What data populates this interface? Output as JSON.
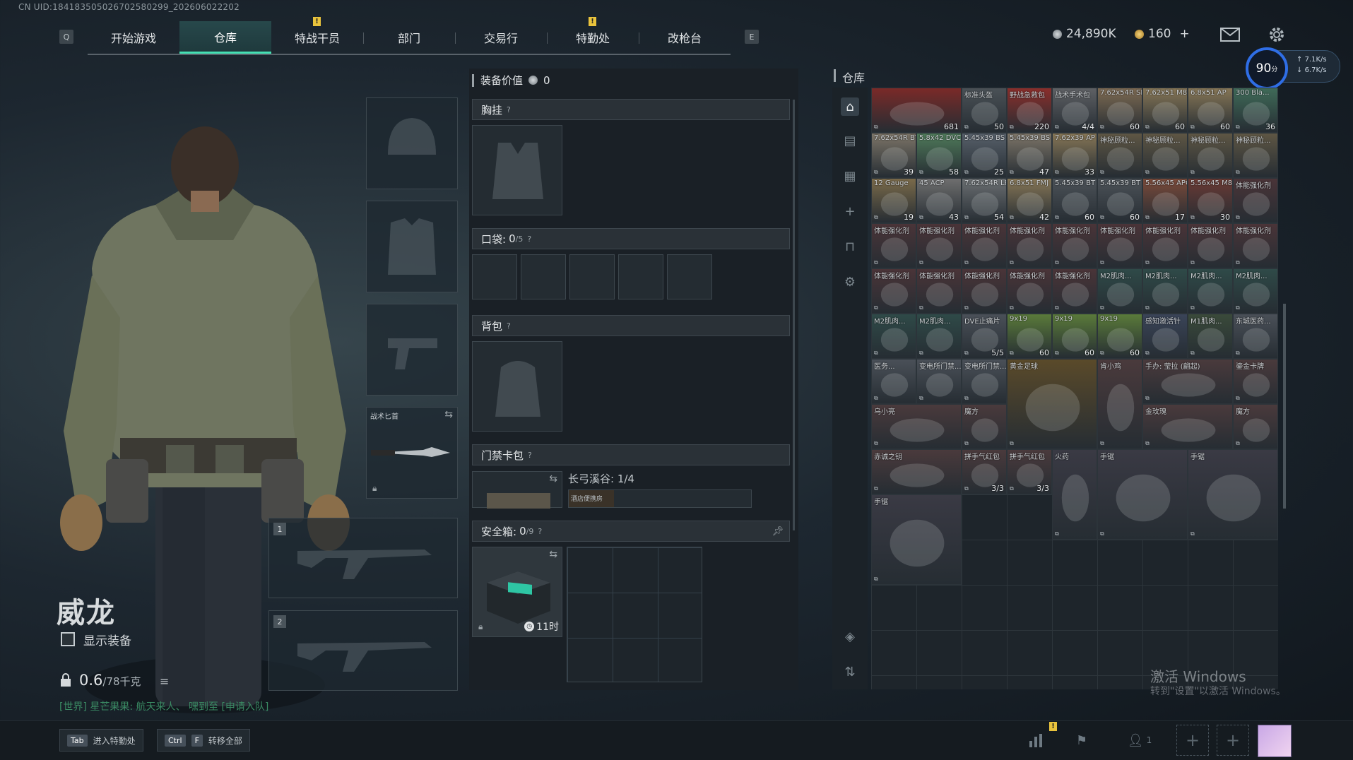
{
  "uid": "CN UID:18418350502670258029‍9_20260602220‍2",
  "nav": {
    "key_left": "Q",
    "key_right": "E",
    "tabs": [
      {
        "label": "开始游戏",
        "active": false,
        "alert": false
      },
      {
        "label": "仓库",
        "active": true,
        "alert": false
      },
      {
        "label": "特战干员",
        "active": false,
        "alert": true
      },
      {
        "label": "部门",
        "active": false,
        "alert": false
      },
      {
        "label": "交易行",
        "active": false,
        "alert": false
      },
      {
        "label": "特勤处",
        "active": false,
        "alert": true
      },
      {
        "label": "改枪台",
        "active": false,
        "alert": false
      }
    ],
    "alert_mark": "!"
  },
  "currency": {
    "silver": "24,890K",
    "gold": "160",
    "gold_add": "+"
  },
  "network": {
    "ping": "90",
    "ping_unit": "分",
    "up": "7.1K/s",
    "down": "6.7K/s"
  },
  "character": {
    "name": "威龙",
    "show_gear_label": "显示装备",
    "weight": "0.6",
    "weight_max": "/78千克",
    "chat_text": "[世界] 星芒果果: 航天来人、 嘿到至 [申请入队]"
  },
  "equipment": {
    "melee_label": "战术匕首",
    "slot1": "1",
    "slot2": "2"
  },
  "loadout": {
    "value_label": "装备价值",
    "value": "0",
    "chest_label": "胸挂",
    "pocket_label": "口袋:",
    "pocket_count": "0",
    "pocket_max": "/5",
    "backpack_label": "背包",
    "keycard_label": "门禁卡包",
    "keycard_map": "长弓溪谷: 1/4",
    "keycard_item": "酒店便携房",
    "safe_label": "安全箱:",
    "safe_count": "0",
    "safe_max": "/9",
    "safe_timer": "11时",
    "help": "?"
  },
  "warehouse": {
    "title": "仓库",
    "items": [
      {
        "name": "",
        "count": "681",
        "color": "#7a2a28",
        "w": 2,
        "h": 1
      },
      {
        "name": "标准头盔",
        "count": "50",
        "color": "#4a5156",
        "w": 1,
        "h": 1
      },
      {
        "name": "野战急救包",
        "count": "220",
        "color": "#8a2e2b",
        "w": 1,
        "h": 1
      },
      {
        "name": "战术手术包",
        "count": "4/4",
        "color": "#5e6064",
        "w": 1,
        "h": 1
      },
      {
        "name": "7.62x54R SNB",
        "count": "60",
        "color": "#7d6a52",
        "w": 1,
        "h": 1
      },
      {
        "name": "7.62x51 M80",
        "count": "60",
        "color": "#867656",
        "w": 1,
        "h": 1
      },
      {
        "name": "6.8x51 AP",
        "count": "60",
        "color": "#867656",
        "w": 1,
        "h": 1
      },
      {
        "name": "300 Bla...",
        "count": "36",
        "color": "#3f6a58",
        "w": 1,
        "h": 1
      },
      {
        "name": "7.62x54R BT",
        "count": "39",
        "color": "#7d7568",
        "w": 1,
        "h": 1
      },
      {
        "name": "5.8x42 DVC12",
        "count": "58",
        "color": "#4f7a5a",
        "w": 1,
        "h": 1
      },
      {
        "name": "5.45x39 BS",
        "count": "25",
        "color": "#57606a",
        "w": 1,
        "h": 1
      },
      {
        "name": "5.45x39 BS",
        "count": "47",
        "color": "#7d7568",
        "w": 1,
        "h": 1
      },
      {
        "name": "7.62x39 AP",
        "count": "33",
        "color": "#867656",
        "w": 1,
        "h": 1
      },
      {
        "name": "神秘顾粒...",
        "count": "",
        "color": "#5e5644",
        "w": 1,
        "h": 1
      },
      {
        "name": "神秘顾粒...",
        "count": "",
        "color": "#5e5644",
        "w": 1,
        "h": 1
      },
      {
        "name": "神秘顾粒...",
        "count": "",
        "color": "#5e5644",
        "w": 1,
        "h": 1
      },
      {
        "name": "神秘顾粒...",
        "count": "",
        "color": "#5e5644",
        "w": 1,
        "h": 1
      },
      {
        "name": "12 Gauge",
        "count": "19",
        "color": "#7a6a4a",
        "w": 1,
        "h": 1
      },
      {
        "name": "45 ACP",
        "count": "43",
        "color": "#6e6e6e",
        "w": 1,
        "h": 1
      },
      {
        "name": "7.62x54R LPS",
        "count": "54",
        "color": "#6b6f72",
        "w": 1,
        "h": 1
      },
      {
        "name": "6.8x51 FMJ",
        "count": "42",
        "color": "#867656",
        "w": 1,
        "h": 1
      },
      {
        "name": "5.45x39 BT",
        "count": "60",
        "color": "#4c5258",
        "w": 1,
        "h": 1
      },
      {
        "name": "5.45x39 BT",
        "count": "60",
        "color": "#4c5258",
        "w": 1,
        "h": 1
      },
      {
        "name": "5.56x45 APC",
        "count": "17",
        "color": "#7a4a3a",
        "w": 1,
        "h": 1
      },
      {
        "name": "5.56x45 M855A1",
        "count": "30",
        "color": "#6a3a34",
        "w": 1,
        "h": 1
      },
      {
        "name": "体能强化剂",
        "count": "",
        "color": "#4a3438",
        "w": 1,
        "h": 1
      },
      {
        "name": "体能强化剂",
        "count": "",
        "color": "#4a3438",
        "w": 1,
        "h": 1
      },
      {
        "name": "体能强化剂",
        "count": "",
        "color": "#4a3438",
        "w": 1,
        "h": 1
      },
      {
        "name": "体能强化剂",
        "count": "",
        "color": "#4a3438",
        "w": 1,
        "h": 1
      },
      {
        "name": "体能强化剂",
        "count": "",
        "color": "#4a3438",
        "w": 1,
        "h": 1
      },
      {
        "name": "体能强化剂",
        "count": "",
        "color": "#4a3438",
        "w": 1,
        "h": 1
      },
      {
        "name": "体能强化剂",
        "count": "",
        "color": "#4a3438",
        "w": 1,
        "h": 1
      },
      {
        "name": "体能强化剂",
        "count": "",
        "color": "#4a3438",
        "w": 1,
        "h": 1
      },
      {
        "name": "体能强化剂",
        "count": "",
        "color": "#4a3438",
        "w": 1,
        "h": 1
      },
      {
        "name": "体能强化剂",
        "count": "",
        "color": "#4a3438",
        "w": 1,
        "h": 1
      },
      {
        "name": "体能强化剂",
        "count": "",
        "color": "#4a3438",
        "w": 1,
        "h": 1
      },
      {
        "name": "体能强化剂",
        "count": "",
        "color": "#4a3438",
        "w": 1,
        "h": 1
      },
      {
        "name": "体能强化剂",
        "count": "",
        "color": "#4a3438",
        "w": 1,
        "h": 1
      },
      {
        "name": "体能强化剂",
        "count": "",
        "color": "#4a3438",
        "w": 1,
        "h": 1
      },
      {
        "name": "体能强化剂",
        "count": "",
        "color": "#4a3438",
        "w": 1,
        "h": 1
      },
      {
        "name": "M2肌肉...",
        "count": "",
        "color": "#2f4a48",
        "w": 1,
        "h": 1
      },
      {
        "name": "M2肌肉...",
        "count": "",
        "color": "#2f4a48",
        "w": 1,
        "h": 1
      },
      {
        "name": "M2肌肉...",
        "count": "",
        "color": "#2f4a48",
        "w": 1,
        "h": 1
      },
      {
        "name": "M2肌肉...",
        "count": "",
        "color": "#2f4a48",
        "w": 1,
        "h": 1
      },
      {
        "name": "M2肌肉...",
        "count": "",
        "color": "#2f4a48",
        "w": 1,
        "h": 1
      },
      {
        "name": "M2肌肉...",
        "count": "",
        "color": "#2f4a48",
        "w": 1,
        "h": 1
      },
      {
        "name": "DVE止痛片",
        "count": "5/5",
        "color": "#4a5058",
        "w": 1,
        "h": 1
      },
      {
        "name": "9x19",
        "count": "60",
        "color": "#5a7a3a",
        "w": 1,
        "h": 1
      },
      {
        "name": "9x19",
        "count": "60",
        "color": "#5a7a3a",
        "w": 1,
        "h": 1
      },
      {
        "name": "9x19",
        "count": "60",
        "color": "#5a7a3a",
        "w": 1,
        "h": 1
      },
      {
        "name": "感知激活针",
        "count": "",
        "color": "#3a4458",
        "w": 1,
        "h": 1
      },
      {
        "name": "M1肌肉...",
        "count": "",
        "color": "#3a4a3a",
        "w": 1,
        "h": 1
      },
      {
        "name": "东城医药...",
        "count": "",
        "color": "#4a5058",
        "w": 1,
        "h": 1
      },
      {
        "name": "医务...",
        "count": "",
        "color": "#4a5058",
        "w": 1,
        "h": 1
      },
      {
        "name": "变电所门禁...",
        "count": "",
        "color": "#4a5058",
        "w": 1,
        "h": 1
      },
      {
        "name": "变电所门禁...",
        "count": "",
        "color": "#4a5058",
        "w": 1,
        "h": 1
      },
      {
        "name": "黄金足球",
        "count": "",
        "color": "#5a4a2a",
        "w": 2,
        "h": 2
      },
      {
        "name": "肯小鸡",
        "count": "",
        "color": "#4a3a3c",
        "w": 1,
        "h": 2
      },
      {
        "name": "手办: 莹拉 (翩起)",
        "count": "",
        "color": "#4a3a3c",
        "w": 2,
        "h": 1
      },
      {
        "name": "乌小亮",
        "count": "",
        "color": "#4a3a3c",
        "w": 2,
        "h": 1
      },
      {
        "name": "金玫瑰",
        "count": "",
        "color": "#4a3a3c",
        "w": 2,
        "h": 1
      },
      {
        "name": "赤诚之钥",
        "count": "",
        "color": "#4a3a3c",
        "w": 2,
        "h": 1
      },
      {
        "name": "鎏金卡牌",
        "count": "",
        "color": "#4a3a3c",
        "w": 1,
        "h": 1
      },
      {
        "name": "魔方",
        "count": "",
        "color": "#4a3a3c",
        "w": 1,
        "h": 1
      },
      {
        "name": "魔方",
        "count": "",
        "color": "#4a3a3c",
        "w": 1,
        "h": 1
      },
      {
        "name": "拼手气红包",
        "count": "3/3",
        "color": "#4a3a3c",
        "w": 1,
        "h": 1
      },
      {
        "name": "拼手气红包",
        "count": "3/3",
        "color": "#4a3a3c",
        "w": 1,
        "h": 1
      },
      {
        "name": "火药",
        "count": "",
        "color": "#3a3a44",
        "w": 1,
        "h": 2
      },
      {
        "name": "手锯",
        "count": "",
        "color": "#3a3a44",
        "w": 2,
        "h": 2
      },
      {
        "name": "手锯",
        "count": "",
        "color": "#3a3a44",
        "w": 2,
        "h": 2
      },
      {
        "name": "手锯",
        "count": "",
        "color": "#3a3a44",
        "w": 2,
        "h": 2
      }
    ],
    "watermark_title": "激活 Windows",
    "watermark_sub": "转到\"设置\"以激活 Windows。"
  },
  "bottom": {
    "tab_key": "Tab",
    "tab_label": "进入特勤处",
    "ctrl_key": "Ctrl",
    "f_key": "F",
    "transfer_label": "转移全部",
    "team_count": "1",
    "plus": "+"
  }
}
